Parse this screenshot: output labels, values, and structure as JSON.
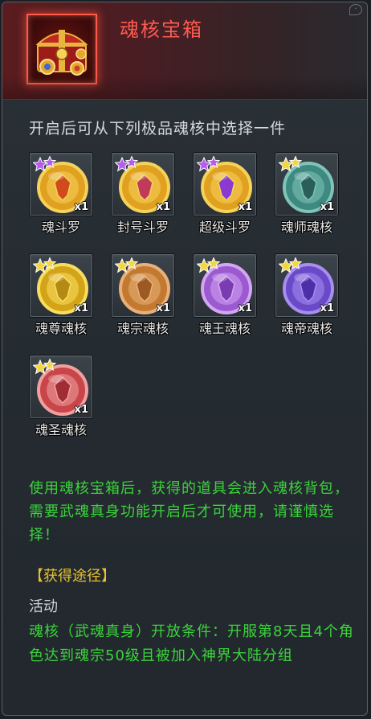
{
  "header": {
    "title": "魂核宝箱",
    "chest_icon": "treasure-chest-icon",
    "info_icon": "corner-tab-icon"
  },
  "subtitle": "开启后可从下列极品魂核中选择一件",
  "items": [
    {
      "name": "魂斗罗",
      "qty": "x1",
      "stars": 2,
      "star_color": "#b65bf0",
      "coin": "#e0a020",
      "ring": "#f5d25a",
      "center": "#d14a1c"
    },
    {
      "name": "封号斗罗",
      "qty": "x1",
      "stars": 2,
      "star_color": "#b65bf0",
      "coin": "#e0a020",
      "ring": "#f5d25a",
      "center": "#c03a5a"
    },
    {
      "name": "超级斗罗",
      "qty": "x1",
      "stars": 2,
      "star_color": "#b65bf0",
      "coin": "#e0a020",
      "ring": "#f5d25a",
      "center": "#8a3ad0"
    },
    {
      "name": "魂师魂核",
      "qty": "x1",
      "stars": 2,
      "star_color": "#f2d640",
      "coin": "#3f8a80",
      "ring": "#7fc4b8",
      "center": "#2a5e58"
    },
    {
      "name": "魂尊魂核",
      "qty": "x1",
      "stars": 2,
      "star_color": "#f2d640",
      "coin": "#d4a418",
      "ring": "#f8de60",
      "center": "#b58a14"
    },
    {
      "name": "魂宗魂核",
      "qty": "x1",
      "stars": 2,
      "star_color": "#f2d640",
      "coin": "#c27a30",
      "ring": "#eab07a",
      "center": "#9c5a22"
    },
    {
      "name": "魂王魂核",
      "qty": "x1",
      "stars": 2,
      "star_color": "#f2d640",
      "coin": "#9b5ad0",
      "ring": "#d4a6f2",
      "center": "#7a3cb0"
    },
    {
      "name": "魂帝魂核",
      "qty": "x1",
      "stars": 2,
      "star_color": "#f2d640",
      "coin": "#6a4ac8",
      "ring": "#a88ef0",
      "center": "#4e2ea8"
    },
    {
      "name": "魂圣魂核",
      "qty": "x1",
      "stars": 2,
      "star_color": "#f2d640",
      "coin": "#c8464a",
      "ring": "#f0a0a0",
      "center": "#a02c34"
    }
  ],
  "description": "使用魂核宝箱后，获得的道具会进入魂核背包，需要武魂真身功能开启后才可使用，请谨慎选择！",
  "acquire_title": "【获得途径】",
  "activity_label": "活动",
  "condition": "魂核（武魂真身）开放条件：开服第8天且4个角色达到魂宗50级且被加入神界大陆分组",
  "colors": {
    "title": "#ff5a50",
    "green_text": "#3bd33b",
    "acquire": "#e7c230"
  }
}
